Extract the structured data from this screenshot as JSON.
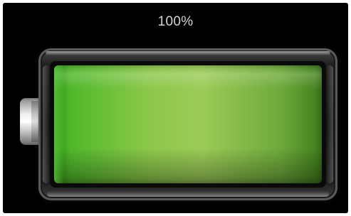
{
  "battery": {
    "percent_label": "100%",
    "charge_fraction": 1.0,
    "fill_color": "#8cc84a",
    "icon": "battery-icon"
  },
  "colors": {
    "background": "#000000",
    "label": "#d4d4d4"
  }
}
